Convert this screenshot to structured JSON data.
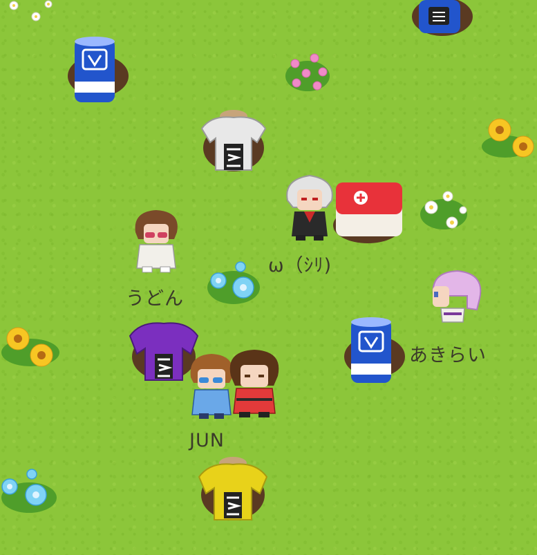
{
  "players": [
    {
      "name": "ω（ｼﾘ)",
      "outfit": "gray-hair-red-coat"
    },
    {
      "name": "うどん",
      "outfit": "white-suit-brown-hair"
    },
    {
      "name": "あきらい",
      "outfit": "pink-hair-white-outfit"
    },
    {
      "name": "JUN",
      "outfit": "blue-outfit-sunglasses"
    }
  ],
  "colors": {
    "grass": "#8cc63a",
    "blue_post": "#2255cc",
    "purple_post": "#7b2fbf",
    "yellow_post": "#e8d21a",
    "white_post": "#e8e8e8",
    "medkit": "#e8323a"
  }
}
